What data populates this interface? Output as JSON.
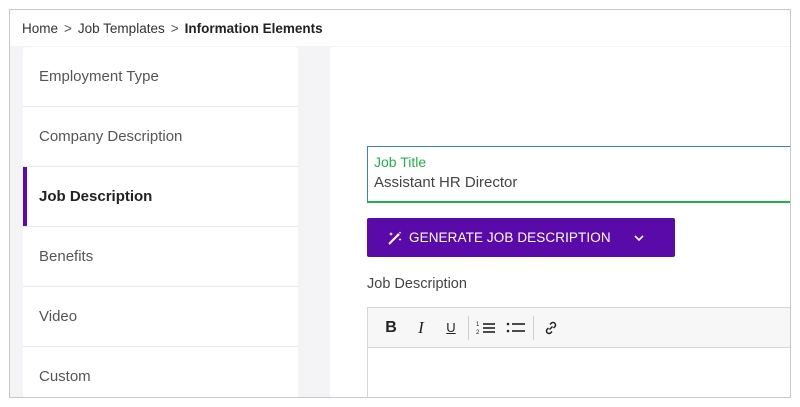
{
  "breadcrumb": {
    "home": "Home",
    "separator": ">",
    "job_templates": "Job Templates",
    "current": "Information Elements"
  },
  "sidebar": {
    "items": [
      {
        "label": "Employment Type",
        "active": false
      },
      {
        "label": "Company Description",
        "active": false
      },
      {
        "label": "Job Description",
        "active": true
      },
      {
        "label": "Benefits",
        "active": false
      },
      {
        "label": "Video",
        "active": false
      },
      {
        "label": "Custom",
        "active": false
      }
    ]
  },
  "form": {
    "job_title_label": "Job Title",
    "job_title_value": "Assistant HR Director",
    "generate_button_label": "GENERATE JOB DESCRIPTION",
    "job_description_label": "Job Description"
  },
  "editor": {
    "toolbar": {
      "bold": "B",
      "italic": "I",
      "underline": "U",
      "icons": [
        "bold-icon",
        "italic-icon",
        "underline-icon",
        "ordered-list-icon",
        "bullet-list-icon",
        "link-icon"
      ]
    }
  },
  "colors": {
    "accent_purple": "#5a0aa8",
    "field_focus_blue": "#3b7ddd",
    "valid_green": "#22b14c"
  }
}
